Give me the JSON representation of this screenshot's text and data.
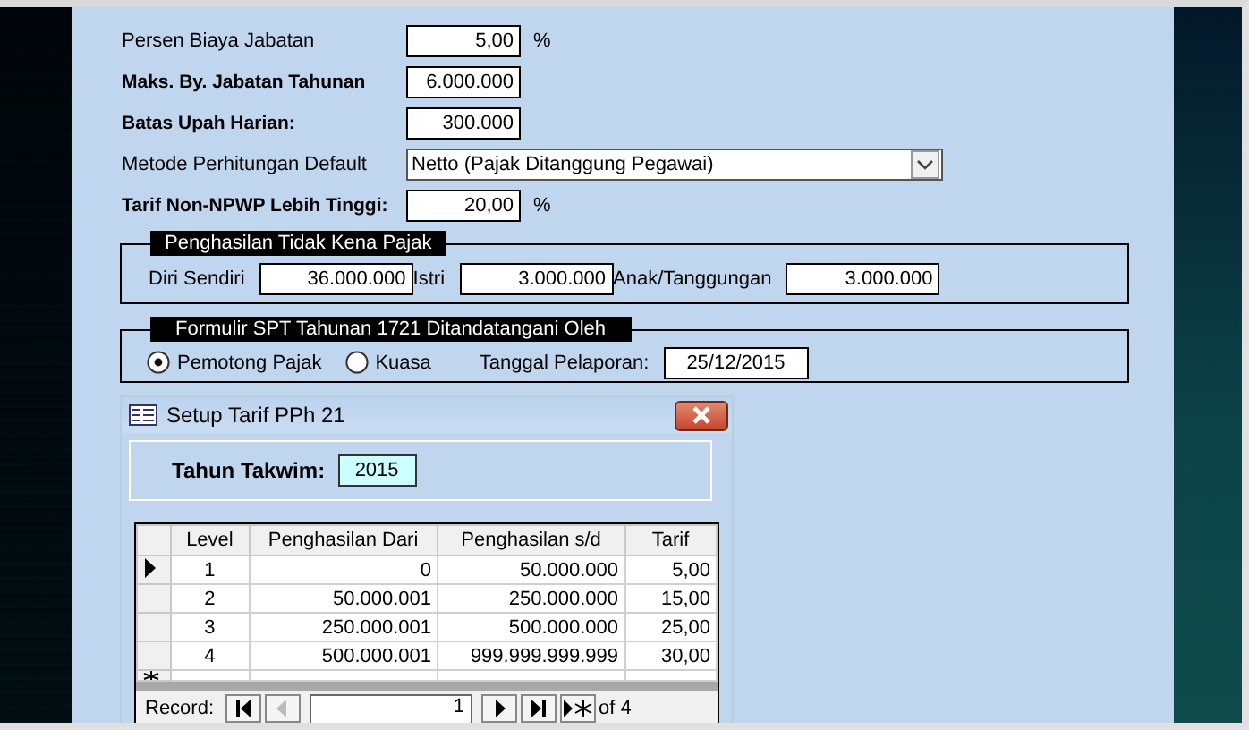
{
  "settings": [
    {
      "label": "Persen Biaya Jabatan",
      "bold": false,
      "kind": "field",
      "value": "5,00",
      "unit": "%"
    },
    {
      "label": "Maks. By. Jabatan Tahunan",
      "bold": true,
      "kind": "field",
      "value": "6.000.000"
    },
    {
      "label": "Batas Upah Harian:",
      "bold": true,
      "kind": "field",
      "value": "300.000"
    },
    {
      "label": "Metode Perhitungan Default",
      "bold": false,
      "kind": "select",
      "value": "Netto (Pajak Ditanggung Pegawai)"
    },
    {
      "label": "Tarif Non-NPWP Lebih Tinggi:",
      "bold": true,
      "kind": "field",
      "value": "20,00",
      "unit": "%"
    }
  ],
  "ptkp": {
    "title": "Penghasilan Tidak Kena Pajak",
    "fields": [
      {
        "label": "Diri Sendiri",
        "value": "36.000.000"
      },
      {
        "label": "Istri",
        "value": "3.000.000"
      },
      {
        "label": "Anak/Tanggungan",
        "value": "3.000.000"
      }
    ]
  },
  "spt": {
    "title": "Formulir SPT Tahunan 1721 Ditandatangani Oleh",
    "options": [
      {
        "label": "Pemotong Pajak",
        "selected": true
      },
      {
        "label": "Kuasa",
        "selected": false
      }
    ],
    "date_label": "Tanggal Pelaporan:",
    "date": "25/12/2015"
  },
  "dialog": {
    "title": "Setup Tarif PPh 21",
    "year_label": "Tahun Takwim:",
    "year": "2015",
    "table": {
      "columns": [
        "Level",
        "Penghasilan Dari",
        "Penghasilan s/d",
        "Tarif"
      ],
      "rows": [
        {
          "selected": true,
          "cells": [
            "1",
            "0",
            "50.000.000",
            "5,00"
          ]
        },
        {
          "selected": false,
          "cells": [
            "2",
            "50.000.001",
            "250.000.000",
            "15,00"
          ]
        },
        {
          "selected": false,
          "cells": [
            "3",
            "250.000.001",
            "500.000.000",
            "25,00"
          ]
        },
        {
          "selected": false,
          "cells": [
            "4",
            "500.000.001",
            "999.999.999.999",
            "30,00"
          ]
        }
      ]
    },
    "navigator": {
      "label": "Record:",
      "current": "1",
      "total": "of 4"
    }
  }
}
